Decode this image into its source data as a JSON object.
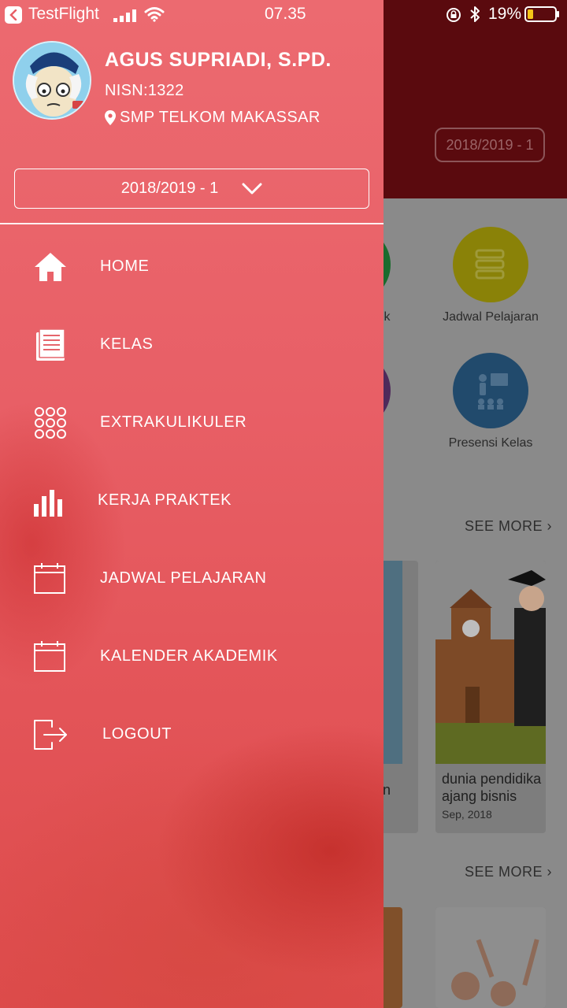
{
  "status_bar": {
    "back_app": "TestFlight",
    "time": "07.35",
    "battery": "19%"
  },
  "drawer": {
    "profile": {
      "name": "AGUS SUPRIADI, S.PD.",
      "nisn": "NISN:1322",
      "school": "SMP TELKOM MAKASSAR"
    },
    "year_select": "2018/2019 - 1",
    "menu": [
      {
        "label": "HOME",
        "icon": "home-icon"
      },
      {
        "label": "KELAS",
        "icon": "document-icon"
      },
      {
        "label": "EXTRAKULIKULER",
        "icon": "grid-dots-icon"
      },
      {
        "label": "KERJA PRAKTEK",
        "icon": "bar-chart-icon"
      },
      {
        "label": "JADWAL PELAJARAN",
        "icon": "calendar-icon"
      },
      {
        "label": "KALENDER AKADEMIK",
        "icon": "calendar-icon"
      },
      {
        "label": "LOGOUT",
        "icon": "logout-icon"
      }
    ]
  },
  "background": {
    "year_badge": "2018/2019 - 1",
    "feature_labels": [
      "ek",
      "Jadwal Pelajaran",
      "Presensi Kelas"
    ],
    "see_more": "SEE MORE",
    "cards": [
      {
        "title_partial": "n"
      },
      {
        "title": "dunia pendidika\najang bisnis",
        "date": "Sep, 2018"
      }
    ]
  },
  "colors": {
    "drawer_top": "#ec6a70",
    "drawer_bottom": "#dd4b4b",
    "header_dark": "#5a0a0e"
  }
}
